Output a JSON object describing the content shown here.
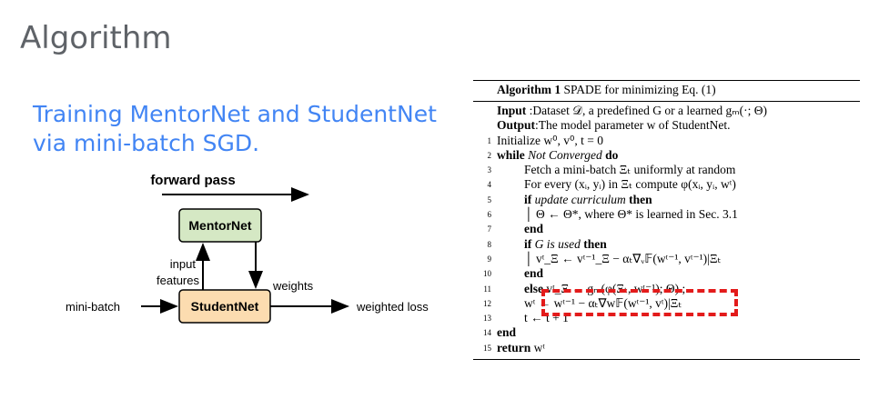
{
  "slide": {
    "title": "Algorithm",
    "subtitle": "Training MentorNet and StudentNet via mini-batch SGD."
  },
  "diagram": {
    "forward_pass": "forward pass",
    "mentornet": "MentorNet",
    "studentnet": "StudentNet",
    "input": "input",
    "features": "features",
    "weights": "weights",
    "mini_batch": "mini-batch",
    "weighted_loss": "weighted loss",
    "colors": {
      "mentornet_fill": "#d5e8c4",
      "studentnet_fill": "#fcdcb0",
      "highlight": "#e31b1b",
      "subtitle": "#4285f4"
    }
  },
  "algorithm": {
    "caption_bold": "Algorithm 1",
    "caption_text": "SPADE for minimizing Eq. (1)",
    "input_label": "Input",
    "input_text": ":Dataset 𝒟, a predefined G or a learned gₘ(·; Θ)",
    "output_label": "Output",
    "output_text": ":The model parameter w of StudentNet.",
    "lines": [
      {
        "n": "1",
        "text": "Initialize w⁰, v⁰, t = 0"
      },
      {
        "n": "2",
        "kw": "while",
        "it": "Not Converged",
        "kw2": "do"
      },
      {
        "n": "3",
        "text": "Fetch a mini-batch Ξₜ uniformly at random"
      },
      {
        "n": "4",
        "text": "For every (xᵢ, yᵢ) in Ξₜ compute φ(xᵢ, yᵢ, wᵗ)"
      },
      {
        "n": "5",
        "kw": "if",
        "it": "update curriculum",
        "kw2": "then"
      },
      {
        "n": "6",
        "text": "│  Θ ← Θ*, where Θ* is learned in Sec. 3.1"
      },
      {
        "n": "7",
        "kw": "end"
      },
      {
        "n": "8",
        "kw": "if",
        "it": "G is used",
        "kw2": "then"
      },
      {
        "n": "9",
        "text": "│  vᵗ_Ξ ← vᵗ⁻¹_Ξ − αₜ∇ᵥ𝔽(wᵗ⁻¹, vᵗ⁻¹)|Ξₜ"
      },
      {
        "n": "10",
        "kw": "end"
      },
      {
        "n": "11",
        "kw": "else",
        "text": "vᵗ_Ξ ← gₘ(φ(Ξₜ, wᵗ⁻¹); Θ) ;"
      },
      {
        "n": "12",
        "text": "wᵗ ← wᵗ⁻¹ − αₜ∇w𝔽(wᵗ⁻¹, vᵗ)|Ξₜ"
      },
      {
        "n": "13",
        "text": "t ← t + 1"
      },
      {
        "n": "14",
        "kw": "end"
      },
      {
        "n": "15",
        "kw": "return",
        "text": "wᵗ"
      }
    ]
  }
}
